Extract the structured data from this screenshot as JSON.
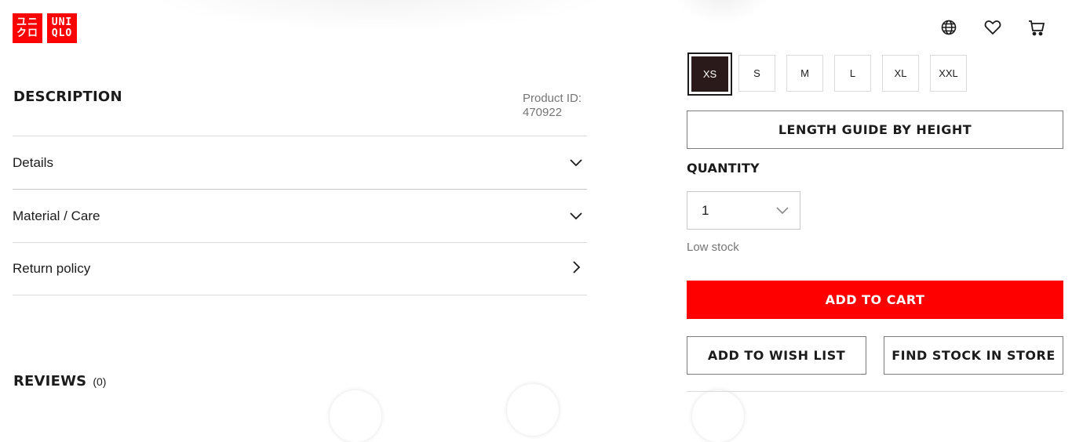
{
  "brand": {
    "logo_line1": "ユニ",
    "logo_line2": "クロ",
    "logo_line3": "UNI",
    "logo_line4": "QLO",
    "color": "#ff0000"
  },
  "header": {
    "icons": [
      "globe-icon",
      "heart-icon",
      "cart-icon"
    ]
  },
  "description": {
    "title": "DESCRIPTION",
    "product_id_label": "Product ID:",
    "product_id": "470922",
    "rows": [
      {
        "label": "Details",
        "icon": "chevron-down-icon"
      },
      {
        "label": "Material / Care",
        "icon": "chevron-down-icon"
      },
      {
        "label": "Return policy",
        "icon": "chevron-right-icon"
      }
    ]
  },
  "reviews": {
    "title": "REVIEWS",
    "count": "(0)"
  },
  "sizes": {
    "options": [
      "XS",
      "S",
      "M",
      "L",
      "XL",
      "XXL"
    ],
    "selected": "XS"
  },
  "length_guide_label": "LENGTH GUIDE BY HEIGHT",
  "quantity": {
    "label": "QUANTITY",
    "value": "1",
    "stock_status": "Low stock"
  },
  "actions": {
    "add_to_cart": "ADD TO CART",
    "add_to_wish_list": "ADD TO WISH LIST",
    "find_stock": "FIND STOCK IN STORE"
  }
}
